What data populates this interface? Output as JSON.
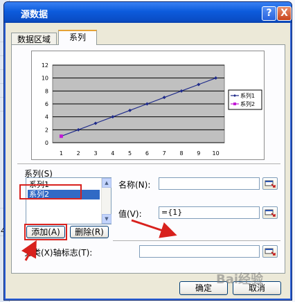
{
  "window": {
    "title": "源数据"
  },
  "titlebar": {
    "help_label": "?",
    "close_label": "X"
  },
  "tabs": [
    {
      "label": "数据区域"
    },
    {
      "label": "系列"
    }
  ],
  "chart_data": {
    "type": "line",
    "x": [
      1,
      2,
      3,
      4,
      5,
      6,
      7,
      8,
      9,
      10
    ],
    "ylim": [
      0,
      12
    ],
    "yticks": [
      0,
      2,
      4,
      6,
      8,
      10,
      12
    ],
    "grid": true,
    "legend_position": "right",
    "series": [
      {
        "name": "系列1",
        "values": [
          1,
          2,
          3,
          4,
          5,
          6,
          7,
          8,
          9,
          10
        ],
        "color": "#1f2b8a"
      },
      {
        "name": "系列2",
        "values": [
          1
        ],
        "color": "#c31ad6"
      }
    ]
  },
  "series_section": {
    "label": "系列(S)",
    "items": [
      {
        "label": "系列1",
        "selected": false
      },
      {
        "label": "系列2",
        "selected": true
      }
    ],
    "add_button": "添加(A)",
    "delete_button": "删除(R)"
  },
  "name_field": {
    "label": "名称(N):",
    "value": ""
  },
  "value_field": {
    "label": "值(V):",
    "value": "={1}"
  },
  "category_field": {
    "label": "分类(X)轴标志(T):",
    "value": ""
  },
  "footer": {
    "ok_label": "确定",
    "cancel_label": "取消"
  },
  "sheet_edge": {
    "row_digit": "4"
  },
  "watermark": "Bai经验",
  "colors": {
    "accent_red": "#d8211d",
    "titlebar": "#0c5bdc",
    "selection": "#316ac5"
  }
}
